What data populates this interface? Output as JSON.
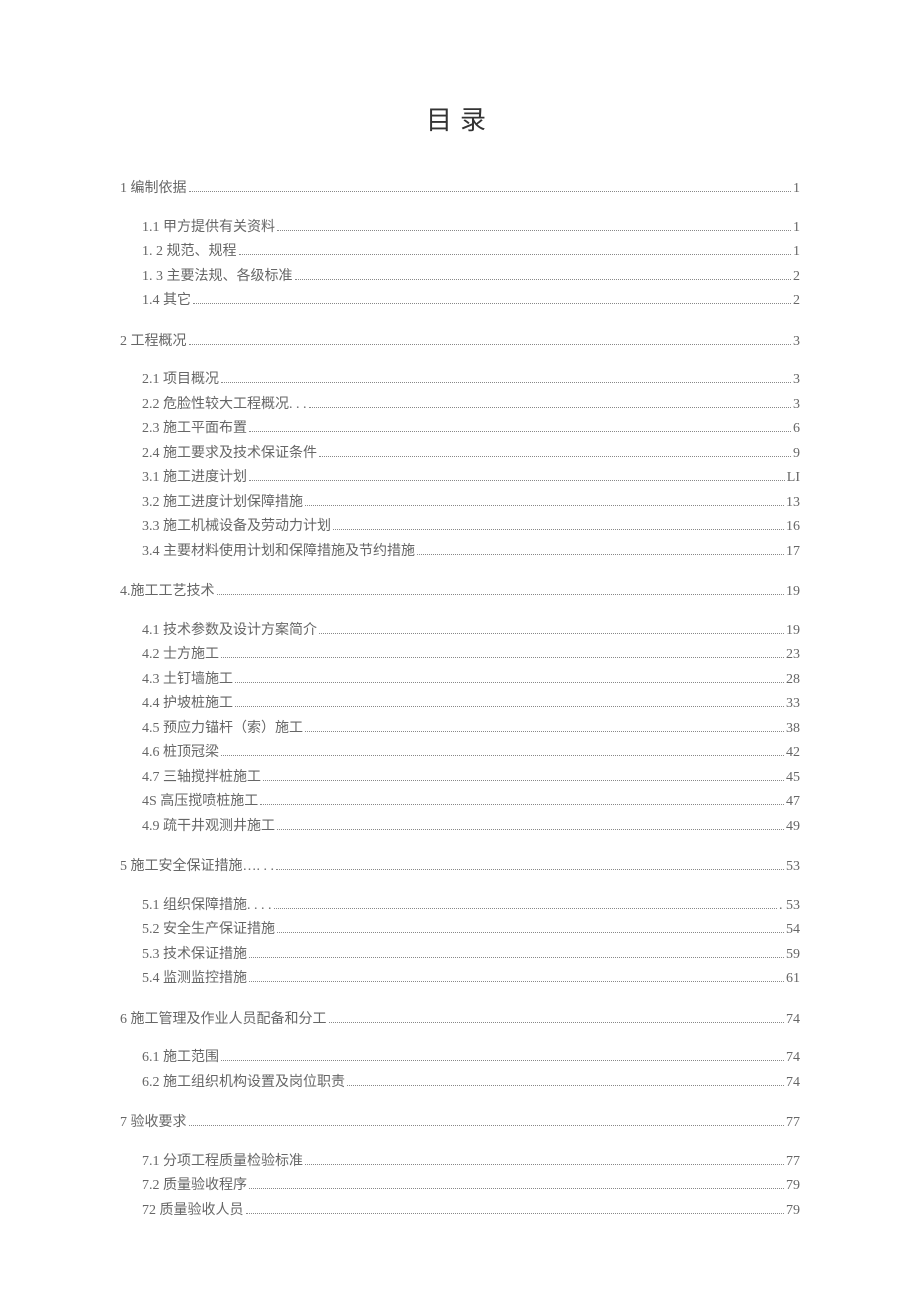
{
  "title": "目录",
  "toc": [
    {
      "heading": {
        "label": "1 编制依据",
        "page": "1"
      },
      "children": [
        {
          "label": "1.1 甲方提供有关资料",
          "page": "1"
        },
        {
          "label": "1. 2 规范、规程",
          "page": "1"
        },
        {
          "label": "1. 3 主要法规、各级标准",
          "page": "2"
        },
        {
          "label": "1.4 其它",
          "page": "2"
        }
      ]
    },
    {
      "heading": {
        "label": "2 工程概况",
        "page": "3"
      },
      "children": [
        {
          "label": "2.1 项目概况",
          "page": "3"
        },
        {
          "label": "2.2 危脸性较大工程概况. . .",
          "page": "3"
        },
        {
          "label": "2.3 施工平面布置",
          "page": "6"
        },
        {
          "label": "2.4 施工要求及技术保证条件",
          "page": "9"
        },
        {
          "label": "3.1 施工进度计划",
          "page": "LI"
        },
        {
          "label": "3.2 施工进度计划保障措施",
          "page": "13"
        },
        {
          "label": "3.3 施工机械设备及劳动力计划",
          "page": "16"
        },
        {
          "label": "3.4 主要材料使用计划和保障措施及节约措施",
          "page": "17"
        }
      ]
    },
    {
      "heading": {
        "label": "4.施工工艺技术",
        "page": "19"
      },
      "children": [
        {
          "label": "4.1 技术参数及设计方案简介",
          "page": "19"
        },
        {
          "label": "4.2 士方施工",
          "page": "23"
        },
        {
          "label": "4.3 土钉墙施工",
          "page": "28"
        },
        {
          "label": "4.4 护坡桩施工",
          "page": "33"
        },
        {
          "label": "4.5 预应力锚杆（索）施工",
          "page": "38"
        },
        {
          "label": "4.6 桩顶冠梁",
          "page": "42"
        },
        {
          "label": "4.7 三轴搅拌桩施工",
          "page": "45"
        },
        {
          "label": "4S 高压搅喷桩施工",
          "page": "47"
        },
        {
          "label": "4.9 疏干井观测井施工",
          "page": "49"
        }
      ]
    },
    {
      "heading": {
        "label": "5 施工安全保证措施…. . .",
        "page": "53"
      },
      "children": [
        {
          "label": "5.1 组织保障措施. . . .",
          "page": ". 53"
        },
        {
          "label": "5.2 安全生产保证措施",
          "page": "54"
        },
        {
          "label": "5.3 技术保证措施",
          "page": "59"
        },
        {
          "label": "5.4 监测监控措施",
          "page": "61"
        }
      ]
    },
    {
      "heading": {
        "label": "6 施工管理及作业人员配备和分工",
        "page": "74"
      },
      "children": [
        {
          "label": "6.1 施工范围",
          "page": "74"
        },
        {
          "label": "6.2 施工组织机构设置及岗位职责",
          "page": "74"
        }
      ]
    },
    {
      "heading": {
        "label": "7 验收要求",
        "page": "77"
      },
      "children": [
        {
          "label": "7.1 分项工程质量检验标准",
          "page": "77"
        },
        {
          "label": "7.2 质量验收程序",
          "page": "79"
        },
        {
          "label": "72 质量验收人员",
          "page": "79"
        }
      ]
    }
  ]
}
